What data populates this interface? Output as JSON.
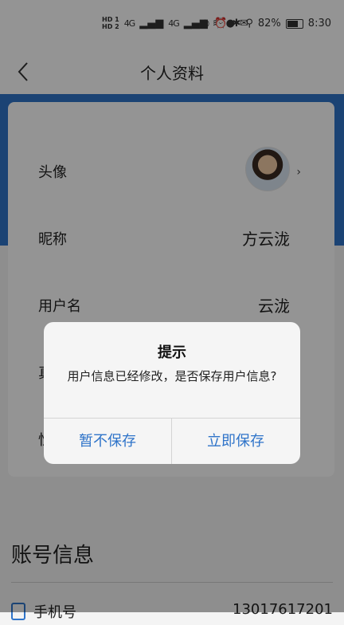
{
  "status_bar": {
    "left": [
      "HD 1",
      "HD 2",
      "4G",
      "4G",
      "wifi",
      "wechat",
      "mail"
    ],
    "battery_percent": "82%",
    "battery_level": 0.82,
    "time": "8:30"
  },
  "header": {
    "title": "个人资料"
  },
  "profile": {
    "avatar_label": "头像",
    "nickname_label": "昵称",
    "nickname_value": "方云泷",
    "username_label": "用户名",
    "username_value": "云泷",
    "row4_label_partial": "真",
    "row5_label_partial": "性"
  },
  "account": {
    "section_title": "账号信息",
    "phone_label": "手机号",
    "phone_value": "13017617201"
  },
  "dialog": {
    "title": "提示",
    "message": "用户信息已经修改，是否保存用户信息?",
    "cancel_label": "暂不保存",
    "confirm_label": "立即保存"
  },
  "colors": {
    "accent": "#2f74c9",
    "overlay": "rgba(0,0,0,0.42)"
  }
}
